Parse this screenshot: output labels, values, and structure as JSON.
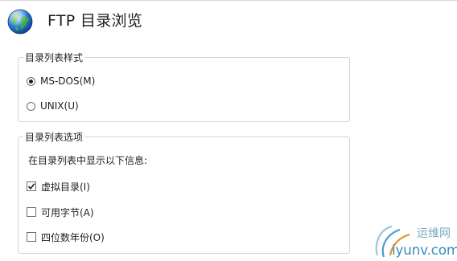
{
  "page": {
    "title": "FTP 目录浏览",
    "icon": "globe-icon"
  },
  "listing_style": {
    "title": "目录列表样式",
    "options": [
      {
        "label": "MS-DOS(M)",
        "selected": true
      },
      {
        "label": "UNIX(U)",
        "selected": false
      }
    ]
  },
  "listing_options": {
    "title": "目录列表选项",
    "description": "在目录列表中显示以下信息:",
    "items": [
      {
        "label": "虚拟目录(I)",
        "checked": true
      },
      {
        "label": "可用字节(A)",
        "checked": false
      },
      {
        "label": "四位数年份(O)",
        "checked": false
      }
    ]
  },
  "watermark": {
    "name": "运维网",
    "url": "iyunv.com"
  }
}
